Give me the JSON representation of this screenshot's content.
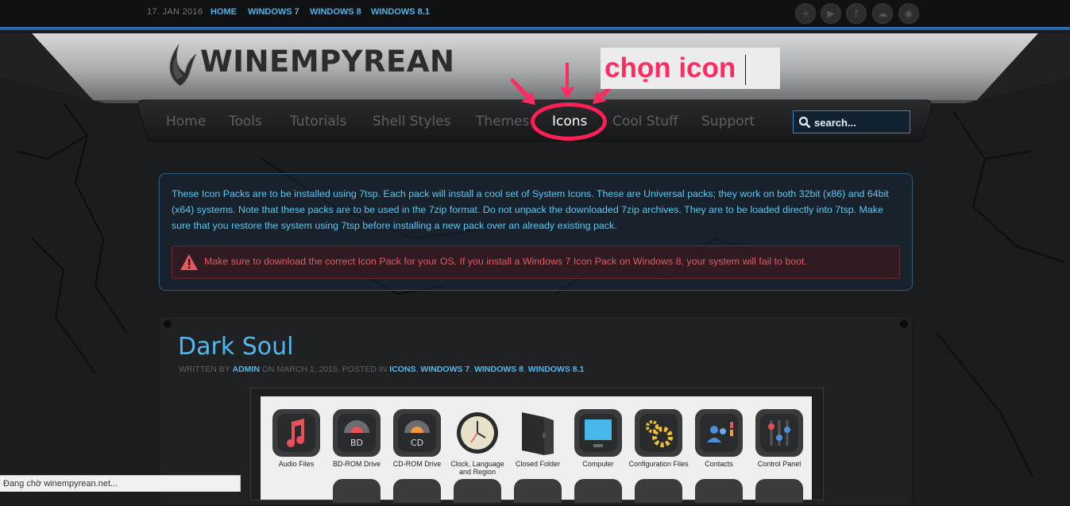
{
  "topbar": {
    "date": "17. JAN 2016",
    "links": [
      "HOME",
      "WINDOWS 7",
      "WINDOWS 8",
      "WINDOWS 8.1"
    ],
    "social_icons": [
      "plus-icon",
      "play-icon",
      "facebook-icon",
      "cloud-icon",
      "rss-icon"
    ]
  },
  "header": {
    "logo": "WINEMPYREAN",
    "nav": [
      {
        "label": "Home"
      },
      {
        "label": "Tools"
      },
      {
        "label": "Tutorials"
      },
      {
        "label": "Shell Styles"
      },
      {
        "label": "Themes"
      },
      {
        "label": "Icons",
        "active": true
      },
      {
        "label": "Cool Stuff"
      },
      {
        "label": "Support"
      }
    ],
    "search_placeholder": "search..."
  },
  "annotation": {
    "text": "chọn icon",
    "color": "#ff2b60"
  },
  "info": {
    "text": "These Icon Packs are to be installed using 7tsp. Each pack will install a cool set of System Icons. These are Universal packs; they work on both 32bit (x86) and 64bit (x64) systems. Note that these packs are to be used in the 7zip format. Do not unpack the downloaded 7zip archives. They are to be loaded directly into 7tsp. Make sure that you restore the system using 7tsp before installing a new pack over an already existing pack.",
    "warning": "Make sure to download the correct Icon Pack for your OS. If you install a Windows 7 Icon Pack on Windows 8, your system will fail to boot."
  },
  "article": {
    "title": "Dark Soul",
    "meta": {
      "written_by": "WRITTEN BY",
      "author": "ADMIN",
      "on": "ON MARCH 1, 2015. POSTED IN",
      "categories": [
        "ICONS",
        "WINDOWS 7",
        "WINDOWS 8",
        "WINDOWS 8.1"
      ]
    },
    "icons": [
      {
        "label": "Audio Files",
        "icon": "music-note-icon"
      },
      {
        "label": "BD-ROM Drive",
        "icon": "bd-drive-icon"
      },
      {
        "label": "CD-ROM Drive",
        "icon": "cd-drive-icon"
      },
      {
        "label": "Clock, Language and Region",
        "icon": "clock-icon"
      },
      {
        "label": "Closed Folder",
        "icon": "folder-icon"
      },
      {
        "label": "Computer",
        "icon": "monitor-icon"
      },
      {
        "label": "Configuration Files",
        "icon": "gears-icon"
      },
      {
        "label": "Contacts",
        "icon": "contacts-icon"
      },
      {
        "label": "Control Panel",
        "icon": "sliders-icon"
      }
    ]
  },
  "status_bar": {
    "text": "Đang chờ winempyrean.net..."
  },
  "colors": {
    "accent": "#4fb8ef",
    "highlight": "#ff1f56",
    "warning": "#e15a62"
  }
}
